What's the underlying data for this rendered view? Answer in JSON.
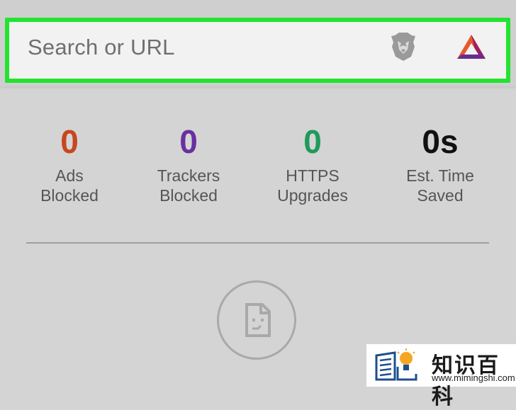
{
  "search": {
    "placeholder": "Search or URL"
  },
  "icons": {
    "shield": "brave-lion-shield-icon",
    "rewards": "bat-rewards-triangle-icon",
    "empty_state": "broken-document-icon"
  },
  "stats": [
    {
      "value": "0",
      "label_line1": "Ads",
      "label_line2": "Blocked",
      "color": "#c8461f"
    },
    {
      "value": "0",
      "label_line1": "Trackers",
      "label_line2": "Blocked",
      "color": "#6a2fa0"
    },
    {
      "value": "0",
      "label_line1": "HTTPS",
      "label_line2": "Upgrades",
      "color": "#1f9a5a"
    },
    {
      "value": "0s",
      "label_line1": "Est. Time",
      "label_line2": "Saved",
      "color": "#111111"
    }
  ],
  "colors": {
    "highlight_border": "#22e42f",
    "search_background": "#f2f2f2",
    "page_background": "#d4d4d4"
  },
  "watermark": {
    "title": "知识百科",
    "url": "www.mimingshi.com"
  }
}
